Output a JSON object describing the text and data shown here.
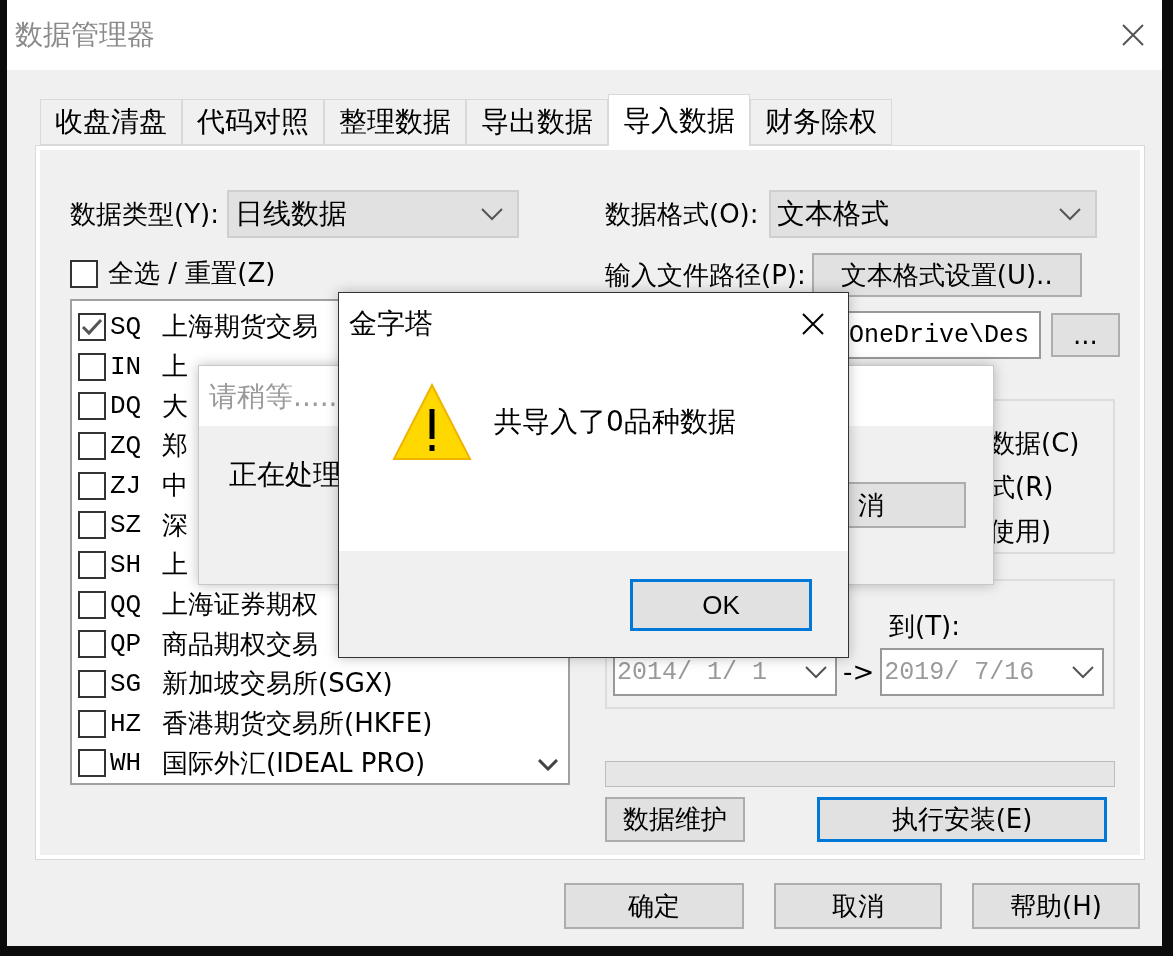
{
  "window": {
    "title": "数据管理器"
  },
  "tabs": [
    {
      "label": "收盘清盘",
      "selected": false
    },
    {
      "label": "代码对照",
      "selected": false
    },
    {
      "label": "整理数据",
      "selected": false
    },
    {
      "label": "导出数据",
      "selected": false
    },
    {
      "label": "导入数据",
      "selected": true
    },
    {
      "label": "财务除权",
      "selected": false
    }
  ],
  "data_type": {
    "label": "数据类型(Y):",
    "value": "日线数据"
  },
  "select_all": {
    "label": "全选 / 重置(Z)",
    "checked": false
  },
  "exchanges": [
    {
      "code": "SQ",
      "name": "上海期货交易",
      "checked": true
    },
    {
      "code": "IN",
      "name": "上",
      "checked": false
    },
    {
      "code": "DQ",
      "name": "大",
      "checked": false
    },
    {
      "code": "ZQ",
      "name": "郑",
      "checked": false
    },
    {
      "code": "ZJ",
      "name": "中",
      "checked": false
    },
    {
      "code": "SZ",
      "name": "深",
      "checked": false
    },
    {
      "code": "SH",
      "name": "上",
      "checked": false
    },
    {
      "code": "QQ",
      "name": "上海证券期权",
      "checked": false
    },
    {
      "code": "QP",
      "name": "商品期权交易",
      "checked": false
    },
    {
      "code": "SG",
      "name": "新加坡交易所(SGX)",
      "checked": false
    },
    {
      "code": "HZ",
      "name": "香港期货交易所(HKFE)",
      "checked": false
    },
    {
      "code": "WH",
      "name": "国际外汇(IDEAL PRO)",
      "checked": false
    }
  ],
  "data_format": {
    "label": "数据格式(O):",
    "value": "文本格式"
  },
  "file_path": {
    "label": "输入文件路径(P):",
    "settings_button": "文本格式设置(U)..",
    "value": "OneDrive\\Des",
    "browse_button": "..."
  },
  "options": [
    "数据(C)",
    "式(R)",
    "使用)"
  ],
  "date_range": {
    "to_label": "到(T):",
    "from": "2014/ 1/ 1",
    "arrow": "->",
    "to": "2019/ 7/16",
    "disabled": true
  },
  "progress": {
    "level": 0
  },
  "action_buttons": [
    {
      "label": "数据维护",
      "focused": false
    },
    {
      "label": "执行安装(E)",
      "focused": true
    }
  ],
  "footer_buttons": [
    "确定",
    "取消",
    "帮助(H)"
  ],
  "wait_dialog": {
    "title": "请稍等.....",
    "message": "正在处理",
    "button": "消"
  },
  "message_box": {
    "title": "金字塔",
    "kind": "warning",
    "message": "共导入了0品种数据",
    "button": "OK",
    "focused": true
  }
}
